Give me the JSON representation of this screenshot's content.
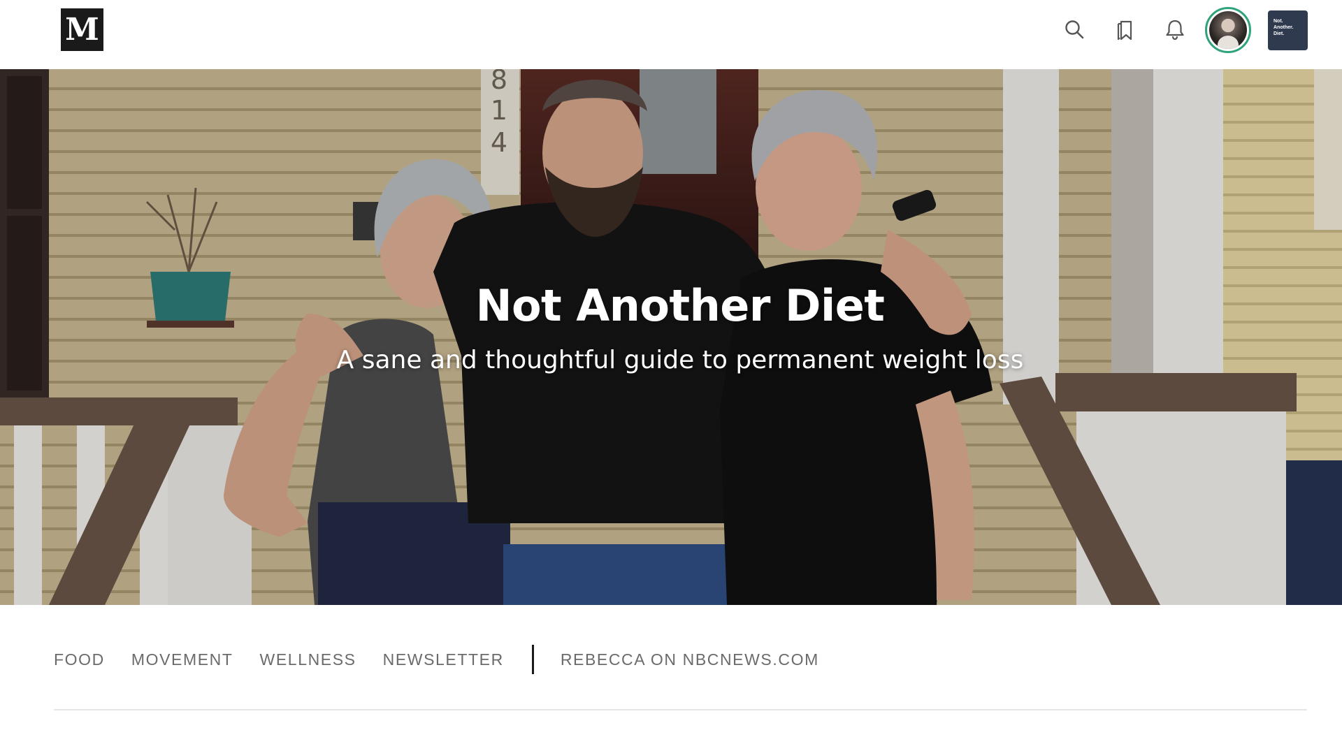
{
  "topbar": {
    "logo_letter": "M",
    "icons": [
      "search-icon",
      "bookmark-icon",
      "bell-icon"
    ],
    "avatar_ring_color": "#2fa37a",
    "publication_badge_text": "Not.\nAnother.\nDiet."
  },
  "hero": {
    "title": "Not Another Diet",
    "subtitle": "A sane and thoughtful guide to permanent weight loss",
    "house_number": "814"
  },
  "nav": {
    "items": [
      {
        "label": "FOOD"
      },
      {
        "label": "MOVEMENT"
      },
      {
        "label": "WELLNESS"
      },
      {
        "label": "NEWSLETTER"
      }
    ],
    "external_link": {
      "label": "REBECCA ON NBCNEWS.COM"
    }
  },
  "colors": {
    "logo_bg": "#1a1a1a",
    "badge_bg": "#2f3a4e",
    "nav_text": "#6b6b6b",
    "divider": "#1a1a1a",
    "rule": "#e6e6e6"
  }
}
